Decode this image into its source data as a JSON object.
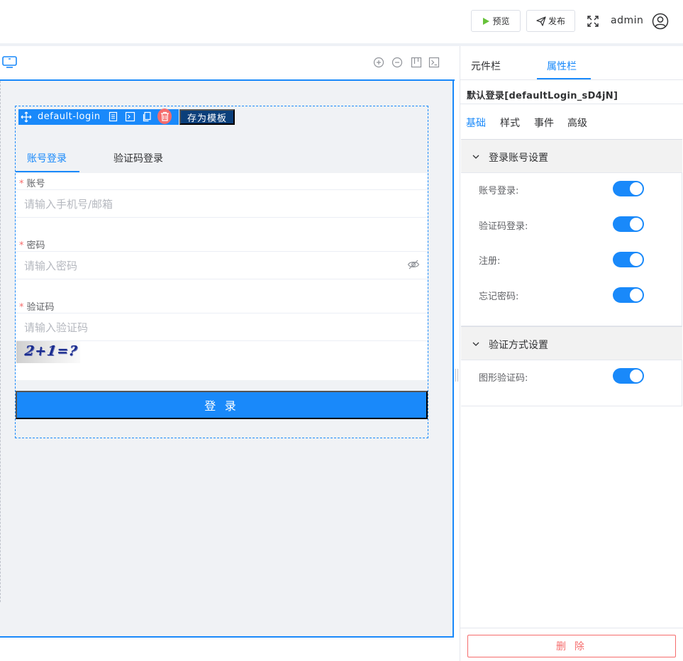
{
  "header": {
    "preview_label": "预览",
    "publish_label": "发布",
    "user_name": "admin"
  },
  "component": {
    "name": "default-login",
    "save_template_label": "存为模板",
    "tabs": [
      {
        "label": "账号登录",
        "active": true
      },
      {
        "label": "验证码登录",
        "active": false
      }
    ],
    "fields": [
      {
        "label": "账号",
        "placeholder": "请输入手机号/邮箱",
        "required": true
      },
      {
        "label": "密码",
        "placeholder": "请输入密码",
        "required": true
      },
      {
        "label": "验证码",
        "placeholder": "请输入验证码",
        "required": true
      }
    ],
    "captcha_text": "2+1=?",
    "login_button": "登 录"
  },
  "panel": {
    "tabs": [
      {
        "label": "元件栏",
        "active": false
      },
      {
        "label": "属性栏",
        "active": true
      }
    ],
    "selected_title": "默认登录[defaultLogin_sD4jN]",
    "sub_tabs": [
      {
        "label": "基础",
        "active": true
      },
      {
        "label": "样式",
        "active": false
      },
      {
        "label": "事件",
        "active": false
      },
      {
        "label": "高级",
        "active": false
      }
    ],
    "sections": [
      {
        "title": "登录账号设置",
        "expanded": true,
        "settings": [
          {
            "label": "账号登录:",
            "enabled": true
          },
          {
            "label": "验证码登录:",
            "enabled": true
          },
          {
            "label": "注册:",
            "enabled": true
          },
          {
            "label": "忘记密码:",
            "enabled": true
          }
        ]
      },
      {
        "title": "验证方式设置",
        "expanded": true,
        "settings": [
          {
            "label": "图形验证码:",
            "enabled": true
          }
        ]
      }
    ],
    "delete_label": "删 除"
  },
  "colors": {
    "primary": "#1989fa",
    "danger": "#f56c6c",
    "canvas_bg": "#f0f2f5",
    "template_button": "#0b3f7a",
    "preview_play": "#67c23a"
  }
}
